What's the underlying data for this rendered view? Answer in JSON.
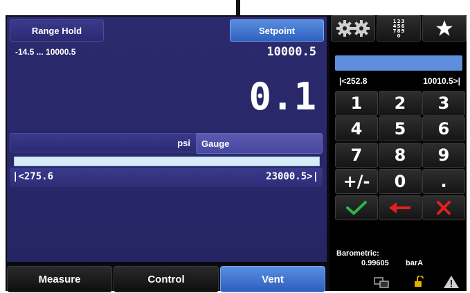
{
  "header": {
    "range_hold_label": "Range Hold",
    "setpoint_label": "Setpoint"
  },
  "range": {
    "text": "-14.5 ... 10000.5",
    "setpoint_value": "10000.5"
  },
  "reading": {
    "value": "0.1"
  },
  "units": {
    "unit": "psi",
    "mode": "Gauge"
  },
  "limits": {
    "low": "|<275.6",
    "high": "23000.5>|"
  },
  "keypad": {
    "entry_value": "",
    "range_low": "|<252.8",
    "range_high": "10010.5>|",
    "keys": [
      "1",
      "2",
      "3",
      "4",
      "5",
      "6",
      "7",
      "8",
      "9",
      "+/-",
      "0",
      "."
    ]
  },
  "barometric": {
    "label": "Barometric:",
    "value": "0.99605",
    "unit": "barA"
  },
  "tabs": {
    "measure": "Measure",
    "control": "Control",
    "vent": "Vent",
    "active": "Vent"
  },
  "icons": {
    "settings": "gears-icon",
    "numeric": "numeric-keypad-icon",
    "favorite": "star-icon",
    "accept": "check-icon",
    "backspace": "arrow-left-icon",
    "cancel": "x-icon",
    "network": "network-icon",
    "lock": "unlock-icon",
    "alert": "warning-icon"
  },
  "colors": {
    "panel": "#2b2a6e",
    "accent_blue": "#3f73d0",
    "check": "#2fb24a",
    "cancel": "#e02020"
  }
}
